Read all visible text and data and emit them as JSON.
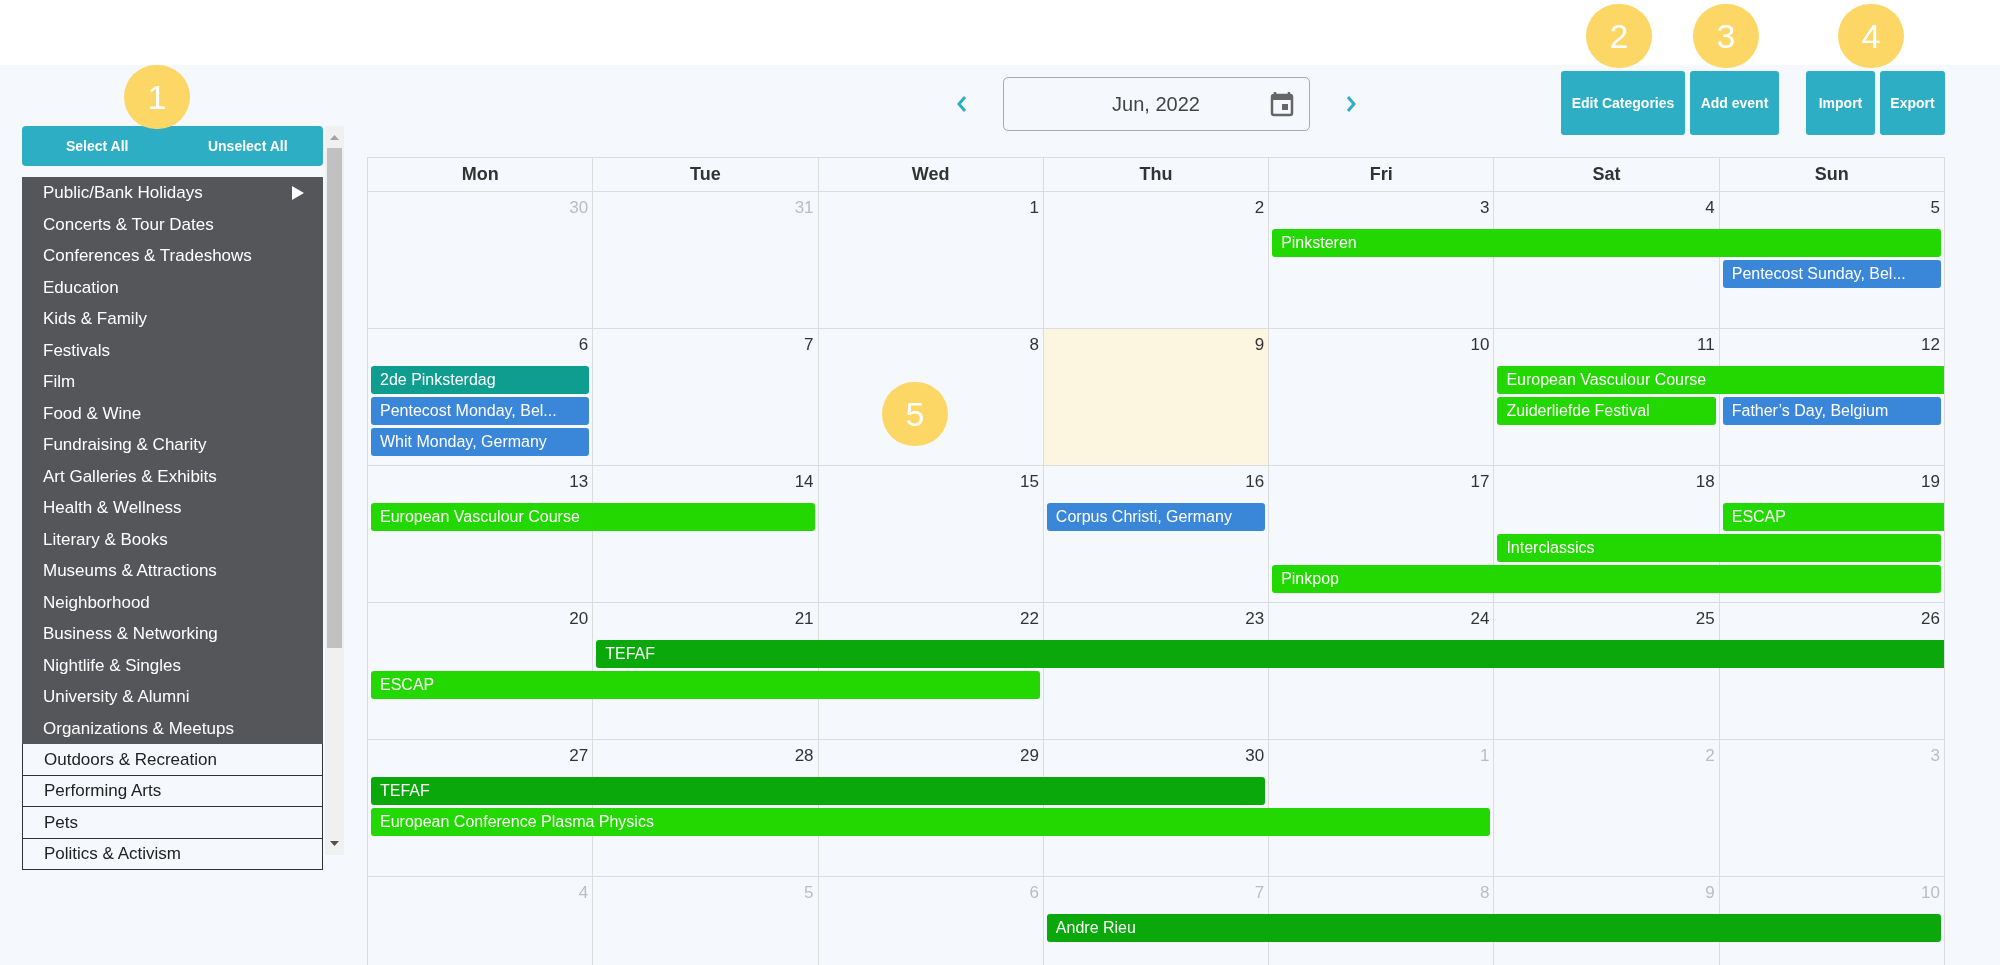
{
  "markers": [
    {
      "label": "1"
    },
    {
      "label": "2"
    },
    {
      "label": "3"
    },
    {
      "label": "4"
    },
    {
      "label": "5"
    }
  ],
  "sidebar": {
    "buttons": [
      "Select All",
      "Unselect All"
    ],
    "items": [
      {
        "label": "Public/Bank Holidays",
        "selected": true,
        "has_submenu": true
      },
      {
        "label": "Concerts & Tour Dates",
        "selected": true,
        "has_submenu": false
      },
      {
        "label": "Conferences & Tradeshows",
        "selected": true,
        "has_submenu": false
      },
      {
        "label": "Education",
        "selected": true,
        "has_submenu": false
      },
      {
        "label": "Kids & Family",
        "selected": true,
        "has_submenu": false
      },
      {
        "label": "Festivals",
        "selected": true,
        "has_submenu": false
      },
      {
        "label": "Film",
        "selected": true,
        "has_submenu": false
      },
      {
        "label": "Food & Wine",
        "selected": true,
        "has_submenu": false
      },
      {
        "label": "Fundraising & Charity",
        "selected": true,
        "has_submenu": false
      },
      {
        "label": "Art Galleries & Exhibits",
        "selected": true,
        "has_submenu": false
      },
      {
        "label": "Health & Wellness",
        "selected": true,
        "has_submenu": false
      },
      {
        "label": "Literary & Books",
        "selected": true,
        "has_submenu": false
      },
      {
        "label": "Museums & Attractions",
        "selected": true,
        "has_submenu": false
      },
      {
        "label": "Neighborhood",
        "selected": true,
        "has_submenu": false
      },
      {
        "label": "Business & Networking",
        "selected": true,
        "has_submenu": false
      },
      {
        "label": "Nightlife & Singles",
        "selected": true,
        "has_submenu": false
      },
      {
        "label": "University & Alumni",
        "selected": true,
        "has_submenu": false
      },
      {
        "label": "Organizations & Meetups",
        "selected": true,
        "has_submenu": false
      },
      {
        "label": "Outdoors & Recreation",
        "selected": false,
        "has_submenu": false
      },
      {
        "label": "Performing Arts",
        "selected": false,
        "has_submenu": false
      },
      {
        "label": "Pets",
        "selected": false,
        "has_submenu": false
      },
      {
        "label": "Politics & Activism",
        "selected": false,
        "has_submenu": false
      }
    ]
  },
  "toolbar": {
    "month": "Jun, 2022",
    "buttons": [
      "Edit Categories",
      "Add event"
    ],
    "file_buttons": [
      "Import",
      "Export"
    ]
  },
  "calendar": {
    "weekdays": [
      "Mon",
      "Tue",
      "Wed",
      "Thu",
      "Fri",
      "Sat",
      "Sun"
    ],
    "weeks": [
      {
        "days": [
          {
            "label": "30",
            "other_month": true,
            "today": false
          },
          {
            "label": "31",
            "other_month": true,
            "today": false
          },
          {
            "label": "1",
            "other_month": false,
            "today": false
          },
          {
            "label": "2",
            "other_month": false,
            "today": false
          },
          {
            "label": "3",
            "other_month": false,
            "today": false,
            "events": [
              {
                "kind": "event",
                "title": "Pinksteren",
                "color": "#22d800",
                "continues": false
              }
            ]
          },
          {
            "label": "4",
            "other_month": false,
            "today": false,
            "events": [
              {
                "kind": "continued"
              }
            ]
          },
          {
            "label": "5",
            "other_month": false,
            "today": false,
            "events": [
              {
                "kind": "continued"
              },
              {
                "kind": "event",
                "title": "Pentecost Sunday, Bel...",
                "color": "#3a87d9",
                "continues": false
              }
            ]
          }
        ]
      },
      {
        "days": [
          {
            "label": "6",
            "other_month": false,
            "today": false,
            "events": [
              {
                "kind": "event",
                "title": "2de Pinksterdag",
                "color": "#0f9d8f",
                "continues": false
              },
              {
                "kind": "event",
                "title": "Pentecost Monday, Bel...",
                "color": "#3a87d9",
                "continues": false
              },
              {
                "kind": "event",
                "title": "Whit Monday, Germany",
                "color": "#3a87d9",
                "continues": false
              }
            ]
          },
          {
            "label": "7",
            "other_month": false,
            "today": false
          },
          {
            "label": "8",
            "other_month": false,
            "today": false
          },
          {
            "label": "9",
            "other_month": false,
            "today": true
          },
          {
            "label": "10",
            "other_month": false,
            "today": false
          },
          {
            "label": "11",
            "other_month": false,
            "today": false,
            "events": [
              {
                "kind": "event",
                "title": "European Vasculour Course",
                "color": "#22d800",
                "continues": true
              },
              {
                "kind": "event",
                "title": "Zuiderliefde Festival",
                "color": "#22d800",
                "continues": false
              }
            ]
          },
          {
            "label": "12",
            "other_month": false,
            "today": false,
            "events": [
              {
                "kind": "continued"
              },
              {
                "kind": "event",
                "title": "Father’s Day, Belgium",
                "color": "#3a87d9",
                "continues": false
              }
            ]
          }
        ]
      },
      {
        "days": [
          {
            "label": "13",
            "other_month": false,
            "today": false,
            "events": [
              {
                "kind": "event",
                "title": "European Vasculour Course",
                "color": "#22d800",
                "continues": false
              }
            ]
          },
          {
            "label": "14",
            "other_month": false,
            "today": false,
            "events": [
              {
                "kind": "continued"
              }
            ]
          },
          {
            "label": "15",
            "other_month": false,
            "today": false
          },
          {
            "label": "16",
            "other_month": false,
            "today": false,
            "events": [
              {
                "kind": "event",
                "title": "Corpus Christi, Germany",
                "color": "#3a87d9",
                "continues": false
              }
            ]
          },
          {
            "label": "17",
            "other_month": false,
            "today": false,
            "events": [
              {
                "kind": "gap"
              },
              {
                "kind": "gap"
              },
              {
                "kind": "event",
                "title": "Pinkpop",
                "color": "#22d800",
                "continues": false
              }
            ]
          },
          {
            "label": "18",
            "other_month": false,
            "today": false,
            "events": [
              {
                "kind": "gap"
              },
              {
                "kind": "event",
                "title": "Interclassics",
                "color": "#22d800",
                "continues": false
              },
              {
                "kind": "continued"
              }
            ]
          },
          {
            "label": "19",
            "other_month": false,
            "today": false,
            "events": [
              {
                "kind": "event",
                "title": "ESCAP",
                "color": "#22d800",
                "continues": true
              },
              {
                "kind": "continued"
              },
              {
                "kind": "continued"
              }
            ]
          }
        ]
      },
      {
        "days": [
          {
            "label": "20",
            "other_month": false,
            "today": false,
            "events": [
              {
                "kind": "gap"
              },
              {
                "kind": "event",
                "title": "ESCAP",
                "color": "#22d800",
                "continues": false
              }
            ]
          },
          {
            "label": "21",
            "other_month": false,
            "today": false,
            "events": [
              {
                "kind": "event",
                "title": "TEFAF",
                "color": "#0aa80a",
                "continues": true
              },
              {
                "kind": "continued"
              }
            ]
          },
          {
            "label": "22",
            "other_month": false,
            "today": false,
            "events": [
              {
                "kind": "continued"
              },
              {
                "kind": "continued"
              }
            ]
          },
          {
            "label": "23",
            "other_month": false,
            "today": false,
            "events": [
              {
                "kind": "continued"
              }
            ]
          },
          {
            "label": "24",
            "other_month": false,
            "today": false,
            "events": [
              {
                "kind": "continued"
              }
            ]
          },
          {
            "label": "25",
            "other_month": false,
            "today": false,
            "events": [
              {
                "kind": "continued"
              }
            ]
          },
          {
            "label": "26",
            "other_month": false,
            "today": false,
            "events": [
              {
                "kind": "continued"
              }
            ]
          }
        ]
      },
      {
        "days": [
          {
            "label": "27",
            "other_month": false,
            "today": false,
            "events": [
              {
                "kind": "event",
                "title": "TEFAF",
                "color": "#0aa80a",
                "continues": false
              },
              {
                "kind": "event",
                "title": "European Conference Plasma Physics",
                "color": "#22d800",
                "continues": false
              }
            ]
          },
          {
            "label": "28",
            "other_month": false,
            "today": false,
            "events": [
              {
                "kind": "continued"
              },
              {
                "kind": "continued"
              }
            ]
          },
          {
            "label": "29",
            "other_month": false,
            "today": false,
            "events": [
              {
                "kind": "continued"
              },
              {
                "kind": "continued"
              }
            ]
          },
          {
            "label": "30",
            "other_month": false,
            "today": false,
            "events": [
              {
                "kind": "continued"
              },
              {
                "kind": "continued"
              }
            ]
          },
          {
            "label": "1",
            "other_month": true,
            "today": false,
            "events": [
              {
                "kind": "gap"
              },
              {
                "kind": "continued"
              }
            ]
          },
          {
            "label": "2",
            "other_month": true,
            "today": false
          },
          {
            "label": "3",
            "other_month": true,
            "today": false
          }
        ]
      },
      {
        "days": [
          {
            "label": "4",
            "other_month": true,
            "today": false
          },
          {
            "label": "5",
            "other_month": true,
            "today": false
          },
          {
            "label": "6",
            "other_month": true,
            "today": false
          },
          {
            "label": "7",
            "other_month": true,
            "today": false,
            "events": [
              {
                "kind": "event",
                "title": "Andre Rieu",
                "color": "#0aa80a",
                "continues": false
              }
            ]
          },
          {
            "label": "8",
            "other_month": true,
            "today": false,
            "events": [
              {
                "kind": "continued"
              }
            ]
          },
          {
            "label": "9",
            "other_month": true,
            "today": false,
            "events": [
              {
                "kind": "continued"
              }
            ]
          },
          {
            "label": "10",
            "other_month": true,
            "today": false,
            "events": [
              {
                "kind": "continued"
              }
            ]
          }
        ]
      }
    ]
  }
}
